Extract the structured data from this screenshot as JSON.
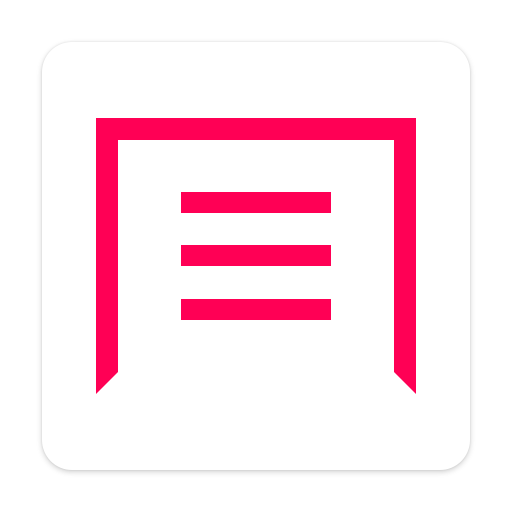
{
  "app_icon": {
    "icon_name": "garage-door-icon",
    "accent_color": "#FF0055",
    "background_color": "#FFFFFF"
  }
}
